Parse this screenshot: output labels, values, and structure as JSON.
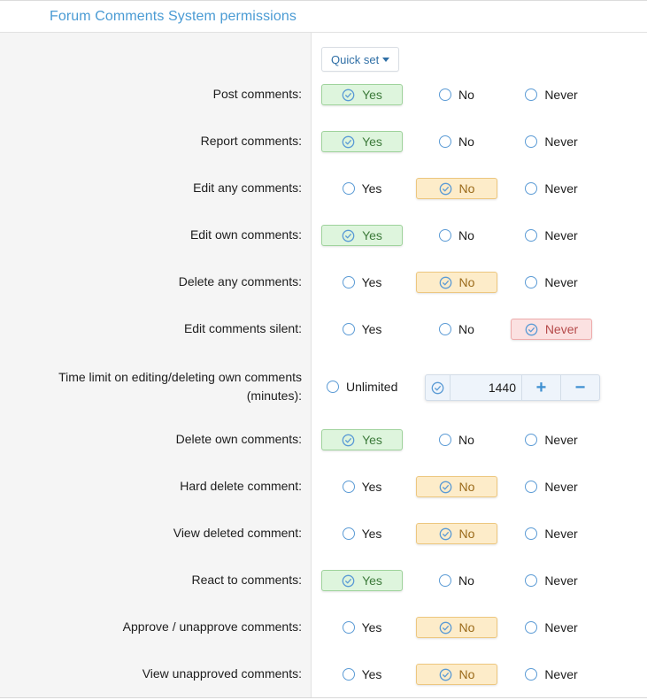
{
  "section": {
    "title": "Forum Comments System permissions"
  },
  "quick_set": {
    "label": "Quick set",
    "icon": "caret-down-icon"
  },
  "options": {
    "yes": "Yes",
    "no": "No",
    "never": "Never",
    "unlimited": "Unlimited"
  },
  "colors": {
    "title": "#4a9bd4",
    "yes": "#def5dd",
    "no": "#fdecc9",
    "never": "#fbe1e1",
    "radio": "#5b9bd5"
  },
  "permissions": [
    {
      "label": "Post comments:",
      "value": "yes"
    },
    {
      "label": "Report comments:",
      "value": "yes"
    },
    {
      "label": "Edit any comments:",
      "value": "no"
    },
    {
      "label": "Edit own comments:",
      "value": "yes"
    },
    {
      "label": "Delete any comments:",
      "value": "no"
    },
    {
      "label": "Edit comments silent:",
      "value": "never"
    },
    {
      "label": "Time limit on editing/deleting own comments (minutes):",
      "type": "integer",
      "unlimited_selected": false,
      "value": "1440",
      "increment_label": "+",
      "decrement_label": "−"
    },
    {
      "label": "Delete own comments:",
      "value": "yes"
    },
    {
      "label": "Hard delete comment:",
      "value": "no"
    },
    {
      "label": "View deleted comment:",
      "value": "no"
    },
    {
      "label": "React to comments:",
      "value": "yes"
    },
    {
      "label": "Approve / unapprove comments:",
      "value": "no"
    },
    {
      "label": "View unapproved comments:",
      "value": "no"
    }
  ]
}
